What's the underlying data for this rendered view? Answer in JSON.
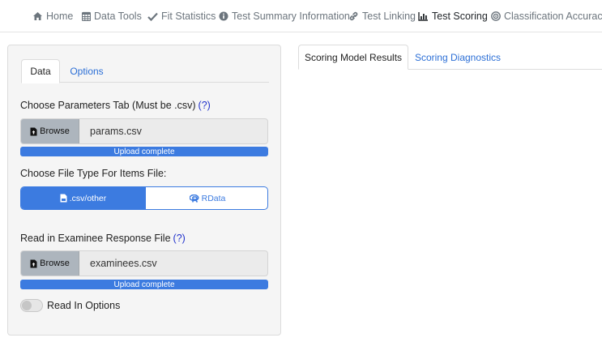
{
  "nav": {
    "items": [
      {
        "label": "Home",
        "icon": "home-icon"
      },
      {
        "label": "Data Tools",
        "icon": "calendar-table-icon"
      },
      {
        "label": "Fit Statistics",
        "icon": "checkmark-icon"
      },
      {
        "label": "Test Summary Information",
        "icon": "info-circle-icon"
      },
      {
        "label": "Test Linking",
        "icon": "link-icon"
      },
      {
        "label": "Test Scoring",
        "icon": "bar-chart-icon",
        "active": true
      },
      {
        "label": "Classification Accuracy",
        "icon": "target-icon"
      }
    ]
  },
  "left_panel": {
    "tabs": [
      {
        "label": "Data",
        "active": true
      },
      {
        "label": "Options",
        "active": false
      }
    ],
    "params": {
      "label": "Choose Parameters Tab (Must be .csv)",
      "help": "(?)",
      "browse_label": "Browse",
      "file_name": "params.csv",
      "progress_text": "Upload complete",
      "progress_percent": 100
    },
    "file_type": {
      "label": "Choose File Type For Items File:",
      "options": [
        {
          "label": ".csv/other",
          "icon": "file-csv-icon",
          "selected": true
        },
        {
          "label": "RData",
          "icon": "r-logo-icon",
          "selected": false
        }
      ]
    },
    "examinee": {
      "label": "Read in Examinee Response File",
      "help": "(?)",
      "browse_label": "Browse",
      "file_name": "examinees.csv",
      "progress_text": "Upload complete",
      "progress_percent": 100
    },
    "read_options": {
      "label": "Read In Options",
      "enabled": false
    }
  },
  "right_panel": {
    "tabs": [
      {
        "label": "Scoring Model Results",
        "active": true
      },
      {
        "label": "Scoring Diagnostics",
        "active": false
      }
    ]
  },
  "colors": {
    "accent": "#3c7be0",
    "link": "#2c6fd6",
    "help": "#2233cc",
    "muted_nav": "#6c757d"
  }
}
